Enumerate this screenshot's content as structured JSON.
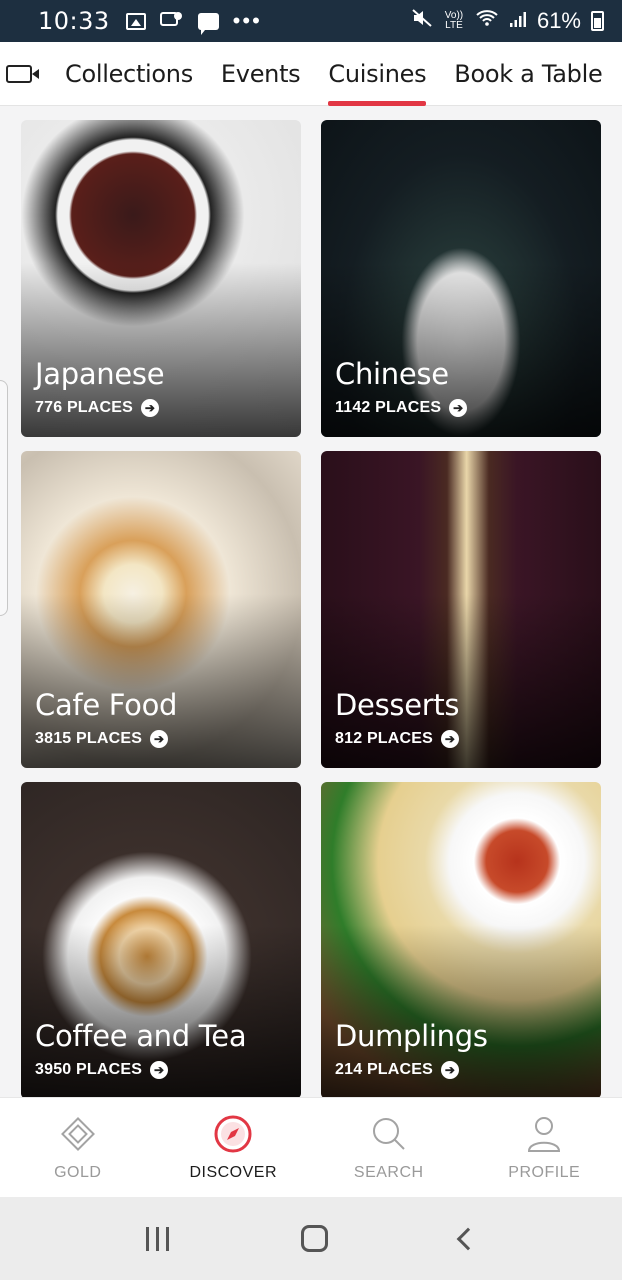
{
  "status_bar": {
    "time": "10:33",
    "battery": "61%",
    "icons_left": [
      "image-icon",
      "notification-icon",
      "message-icon",
      "more-dots-icon"
    ],
    "icons_right": [
      "mute-icon",
      "volte-icon",
      "wifi-icon",
      "signal-icon",
      "battery-icon"
    ],
    "volte_label": "Vo)) LTE"
  },
  "top_tabs": [
    {
      "label": "Collections",
      "active": false
    },
    {
      "label": "Events",
      "active": false
    },
    {
      "label": "Cuisines",
      "active": true
    },
    {
      "label": "Book a Table",
      "active": false
    }
  ],
  "cuisines": [
    {
      "name": "Japanese",
      "places": "776 PLACES"
    },
    {
      "name": "Chinese",
      "places": "1142 PLACES"
    },
    {
      "name": "Cafe Food",
      "places": "3815 PLACES"
    },
    {
      "name": "Desserts",
      "places": "812 PLACES"
    },
    {
      "name": "Coffee and Tea",
      "places": "3950 PLACES"
    },
    {
      "name": "Dumplings",
      "places": "214 PLACES"
    }
  ],
  "bottom_nav": [
    {
      "label": "GOLD",
      "icon": "gold-icon",
      "active": false
    },
    {
      "label": "DISCOVER",
      "icon": "compass-icon",
      "active": true
    },
    {
      "label": "SEARCH",
      "icon": "search-icon",
      "active": false
    },
    {
      "label": "PROFILE",
      "icon": "profile-icon",
      "active": false
    }
  ],
  "colors": {
    "accent": "#e23744",
    "status_bar": "#1d2f40"
  }
}
